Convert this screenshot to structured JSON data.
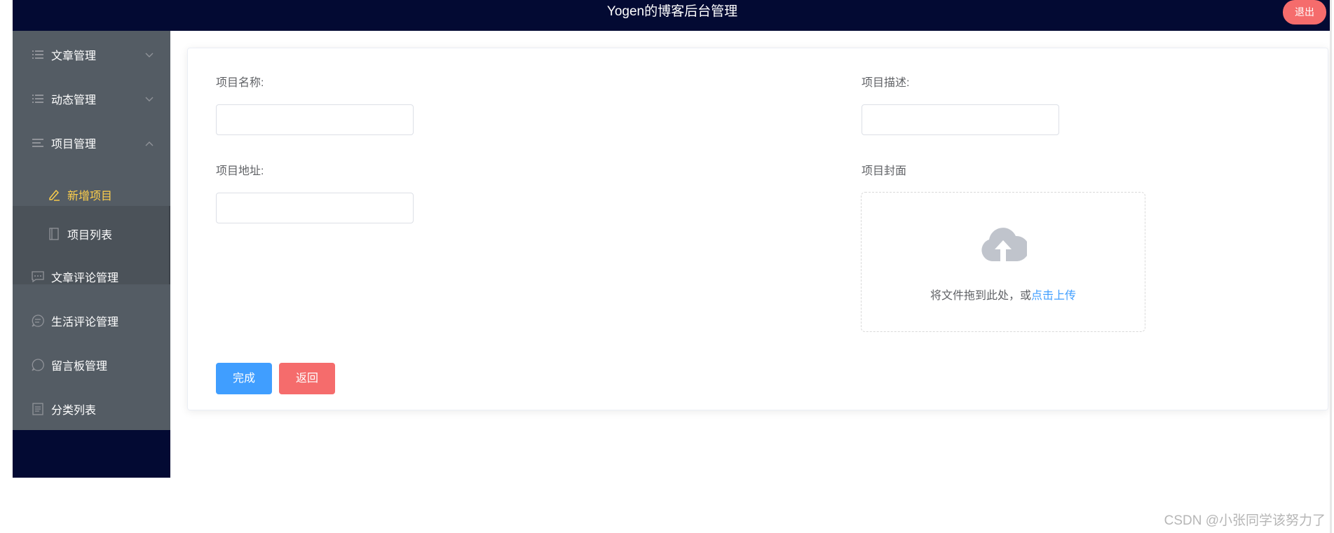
{
  "header": {
    "title": "Yogen的博客后台管理",
    "logout_label": "退出"
  },
  "sidebar": {
    "items": [
      {
        "label": "文章管理",
        "icon": "menu-lines-icon",
        "arrow": "chevron-down-icon"
      },
      {
        "label": "动态管理",
        "icon": "menu-lines-icon",
        "arrow": "chevron-down-icon"
      },
      {
        "label": "项目管理",
        "icon": "menu-lines-icon",
        "arrow": "chevron-up-icon"
      },
      {
        "label": "文章评论管理",
        "icon": "chat-dots-icon"
      },
      {
        "label": "生活评论管理",
        "icon": "chat-lines-icon"
      },
      {
        "label": "留言板管理",
        "icon": "chat-round-icon"
      },
      {
        "label": "分类列表",
        "icon": "document-icon"
      }
    ],
    "subitems": [
      {
        "label": "新增项目",
        "icon": "edit-pen-icon",
        "active": true
      },
      {
        "label": "项目列表",
        "icon": "notebook-icon",
        "active": false
      }
    ]
  },
  "form": {
    "name_label": "项目名称:",
    "name_value": "",
    "desc_label": "项目描述:",
    "desc_value": "",
    "url_label": "项目地址:",
    "url_value": "",
    "cover_label": "项目封面",
    "upload_text": "将文件拖到此处，或",
    "upload_link": "点击上传",
    "submit_label": "完成",
    "back_label": "返回"
  },
  "colors": {
    "header_bg": "#030a33",
    "sidebar_bg": "#545c64",
    "active_text": "#ffd04b",
    "primary": "#409eff",
    "danger": "#f56c6c"
  },
  "watermark": "CSDN @小张同学该努力了"
}
